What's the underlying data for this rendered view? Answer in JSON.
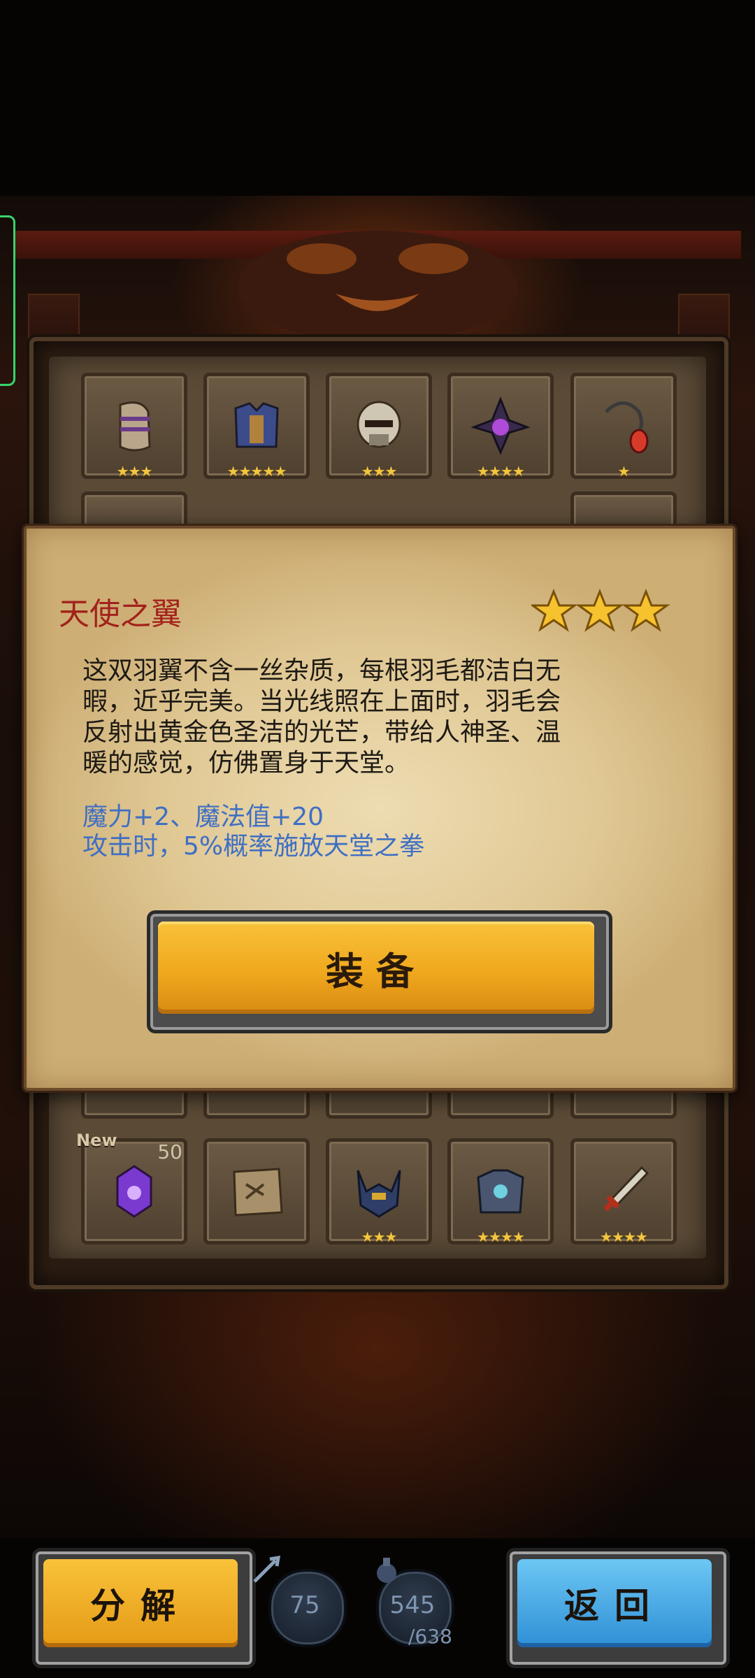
{
  "item": {
    "name": "天使之翼",
    "rarity_stars": 3,
    "description_lines": [
      "这双羽翼不含一丝杂质，每根羽毛都洁白无",
      "暇，近乎完美。当光线照在上面时，羽毛会",
      "反射出黄金色圣洁的光芒，带给人神圣、温",
      "暖的感觉，仿佛置身于天堂。"
    ],
    "stats": [
      "魔力+2、魔法值+20",
      "攻击时，5%概率施放天堂之拳"
    ],
    "equip_label": "装备"
  },
  "inventory": {
    "top_row": [
      {
        "icon": "armor-pauldron-icon",
        "stars": 3
      },
      {
        "icon": "armor-chestplate-icon",
        "stars": 5
      },
      {
        "icon": "skull-helmet-icon",
        "stars": 3
      },
      {
        "icon": "dark-wizard-hat-icon",
        "stars": 4
      },
      {
        "icon": "ruby-amulet-icon",
        "stars": 1
      }
    ],
    "bottom_row": [
      {
        "icon": "purple-gem-icon",
        "stars": 0,
        "new_tag": "New",
        "count": "50"
      },
      {
        "icon": "treasure-map-icon",
        "stars": 0
      },
      {
        "icon": "horned-helmet-icon",
        "stars": 3
      },
      {
        "icon": "spiked-armor-icon",
        "stars": 4
      },
      {
        "icon": "flame-sword-icon",
        "stars": 4
      }
    ]
  },
  "bottom_bar": {
    "decompose_label": "分解",
    "back_label": "返回",
    "resource_1": "75",
    "resource_2": "545",
    "resource_2_max": "/638"
  },
  "colors": {
    "title_red": "#a3211a",
    "stat_blue": "#3e6fc4",
    "gold_button": "#f0a81e",
    "blue_button": "#2f8fd6",
    "star_gold": "#f2c640"
  }
}
